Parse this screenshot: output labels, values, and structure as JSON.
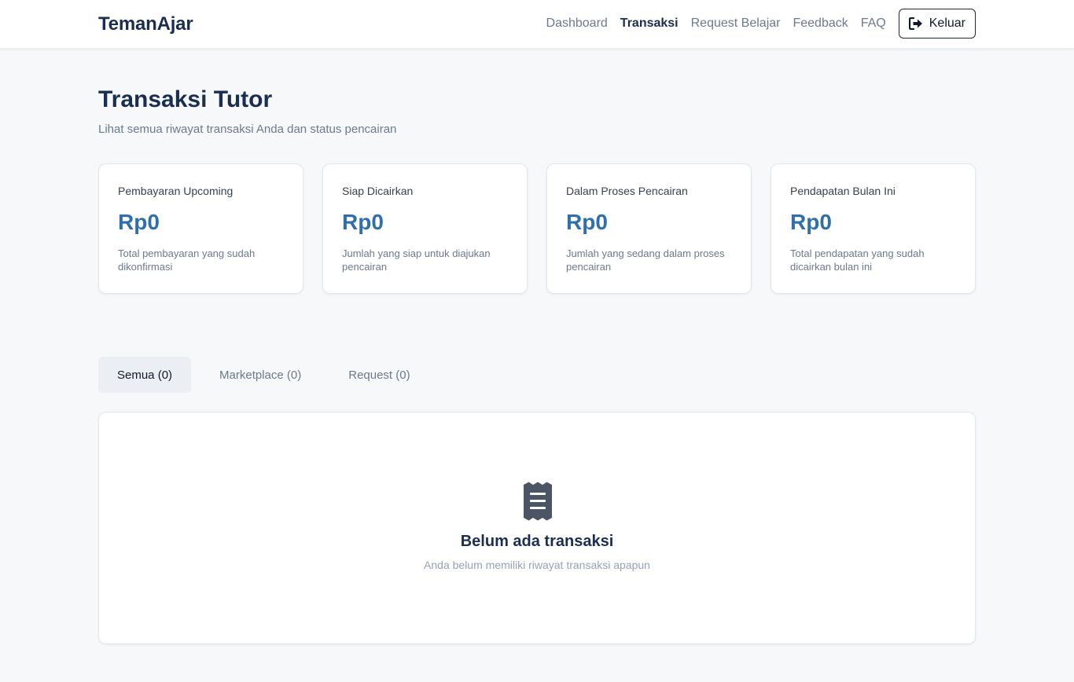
{
  "navbar": {
    "brand": "TemanAjar",
    "links": [
      "Dashboard",
      "Transaksi",
      "Request Belajar",
      "Feedback",
      "FAQ"
    ],
    "active_link": "Transaksi",
    "logout_label": "Keluar"
  },
  "header": {
    "title": "Transaksi Tutor",
    "subtitle": "Lihat semua riwayat transaksi Anda dan status pencairan"
  },
  "cards": [
    {
      "title": "Pembayaran Upcoming",
      "value": "Rp0",
      "desc": "Total pembayaran yang sudah dikonfirmasi"
    },
    {
      "title": "Siap Dicairkan",
      "value": "Rp0",
      "desc": "Jumlah yang siap untuk diajukan pencairan"
    },
    {
      "title": "Dalam Proses Pencairan",
      "value": "Rp0",
      "desc": "Jumlah yang sedang dalam proses pencairan"
    },
    {
      "title": "Pendapatan Bulan Ini",
      "value": "Rp0",
      "desc": "Total pendapatan yang sudah dicairkan bulan ini"
    }
  ],
  "tabs": [
    "Semua (0)",
    "Marketplace (0)",
    "Request (0)"
  ],
  "active_tab": "Semua (0)",
  "empty_state": {
    "icon": "receipt-icon",
    "title": "Belum ada transaksi",
    "desc": "Anda belum memiliki riwayat transaksi apapun"
  },
  "colors": {
    "brand": "#1a2e52",
    "accent_value": "#2f6fae",
    "muted": "#6b7a90",
    "background": "#f6f8fa"
  }
}
